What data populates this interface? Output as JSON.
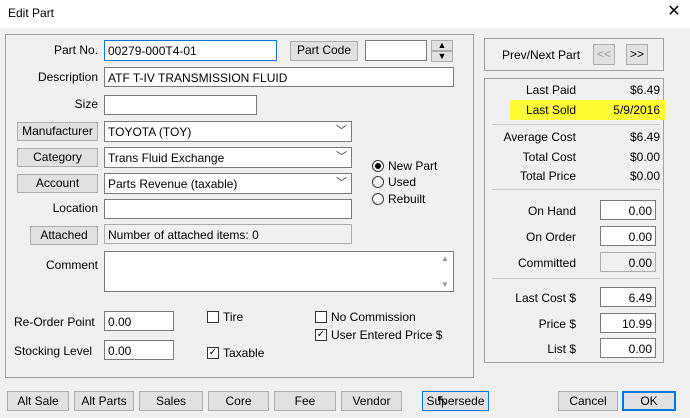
{
  "window": {
    "title": "Edit Part",
    "close_glyph": "✕"
  },
  "form": {
    "part_no_label": "Part No.",
    "part_no_value": "00279-000T4-01",
    "part_code_label": "Part Code",
    "part_code_value": "",
    "description_label": "Description",
    "description_value": "ATF T-IV TRANSMISSION FLUID",
    "size_label": "Size",
    "size_value": "",
    "manufacturer_label": "Manufacturer",
    "manufacturer_value": "TOYOTA (TOY)",
    "category_label": "Category",
    "category_value": "Trans Fluid Exchange",
    "account_label": "Account",
    "account_value": "Parts Revenue (taxable)",
    "location_label": "Location",
    "location_value": "",
    "attached_label": "Attached",
    "attached_text": "Number of attached items: 0",
    "comment_label": "Comment",
    "comment_value": "",
    "reorder_label": "Re-Order Point",
    "reorder_value": "0.00",
    "stocking_label": "Stocking Level",
    "stocking_value": "0.00",
    "tire_label": "Tire",
    "tire_checked": false,
    "taxable_label": "Taxable",
    "taxable_checked": true,
    "no_commission_label": "No Commission",
    "no_commission_checked": false,
    "user_price_label": "User Entered Price $",
    "user_price_checked": true,
    "condition_options": [
      "New Part",
      "Used",
      "Rebuilt"
    ],
    "condition_selected": "New Part"
  },
  "nav": {
    "label": "Prev/Next Part",
    "prev": "<<",
    "next": ">>"
  },
  "pricing": {
    "last_paid_label": "Last Paid",
    "last_paid_value": "$6.49",
    "last_sold_label": "Last Sold",
    "last_sold_value": "5/9/2016",
    "avg_cost_label": "Average Cost",
    "avg_cost_value": "$6.49",
    "total_cost_label": "Total Cost",
    "total_cost_value": "$0.00",
    "total_price_label": "Total Price",
    "total_price_value": "$0.00",
    "on_hand_label": "On Hand",
    "on_hand_value": "0.00",
    "on_order_label": "On Order",
    "on_order_value": "0.00",
    "committed_label": "Committed",
    "committed_value": "0.00",
    "last_cost_label": "Last Cost $",
    "last_cost_value": "6.49",
    "price_label": "Price $",
    "price_value": "10.99",
    "list_label": "List $",
    "list_value": "0.00"
  },
  "footer": {
    "alt_sale": "Alt Sale",
    "alt_parts": "Alt Parts",
    "sales": "Sales",
    "core": "Core",
    "fee": "Fee",
    "vendor": "Vendor",
    "supersede": "Supersede",
    "cancel": "Cancel",
    "ok": "OK"
  },
  "colors": {
    "highlight": "#ffff33",
    "dialog_bg": "#f0f0f0",
    "focus_border": "#0078d7"
  }
}
